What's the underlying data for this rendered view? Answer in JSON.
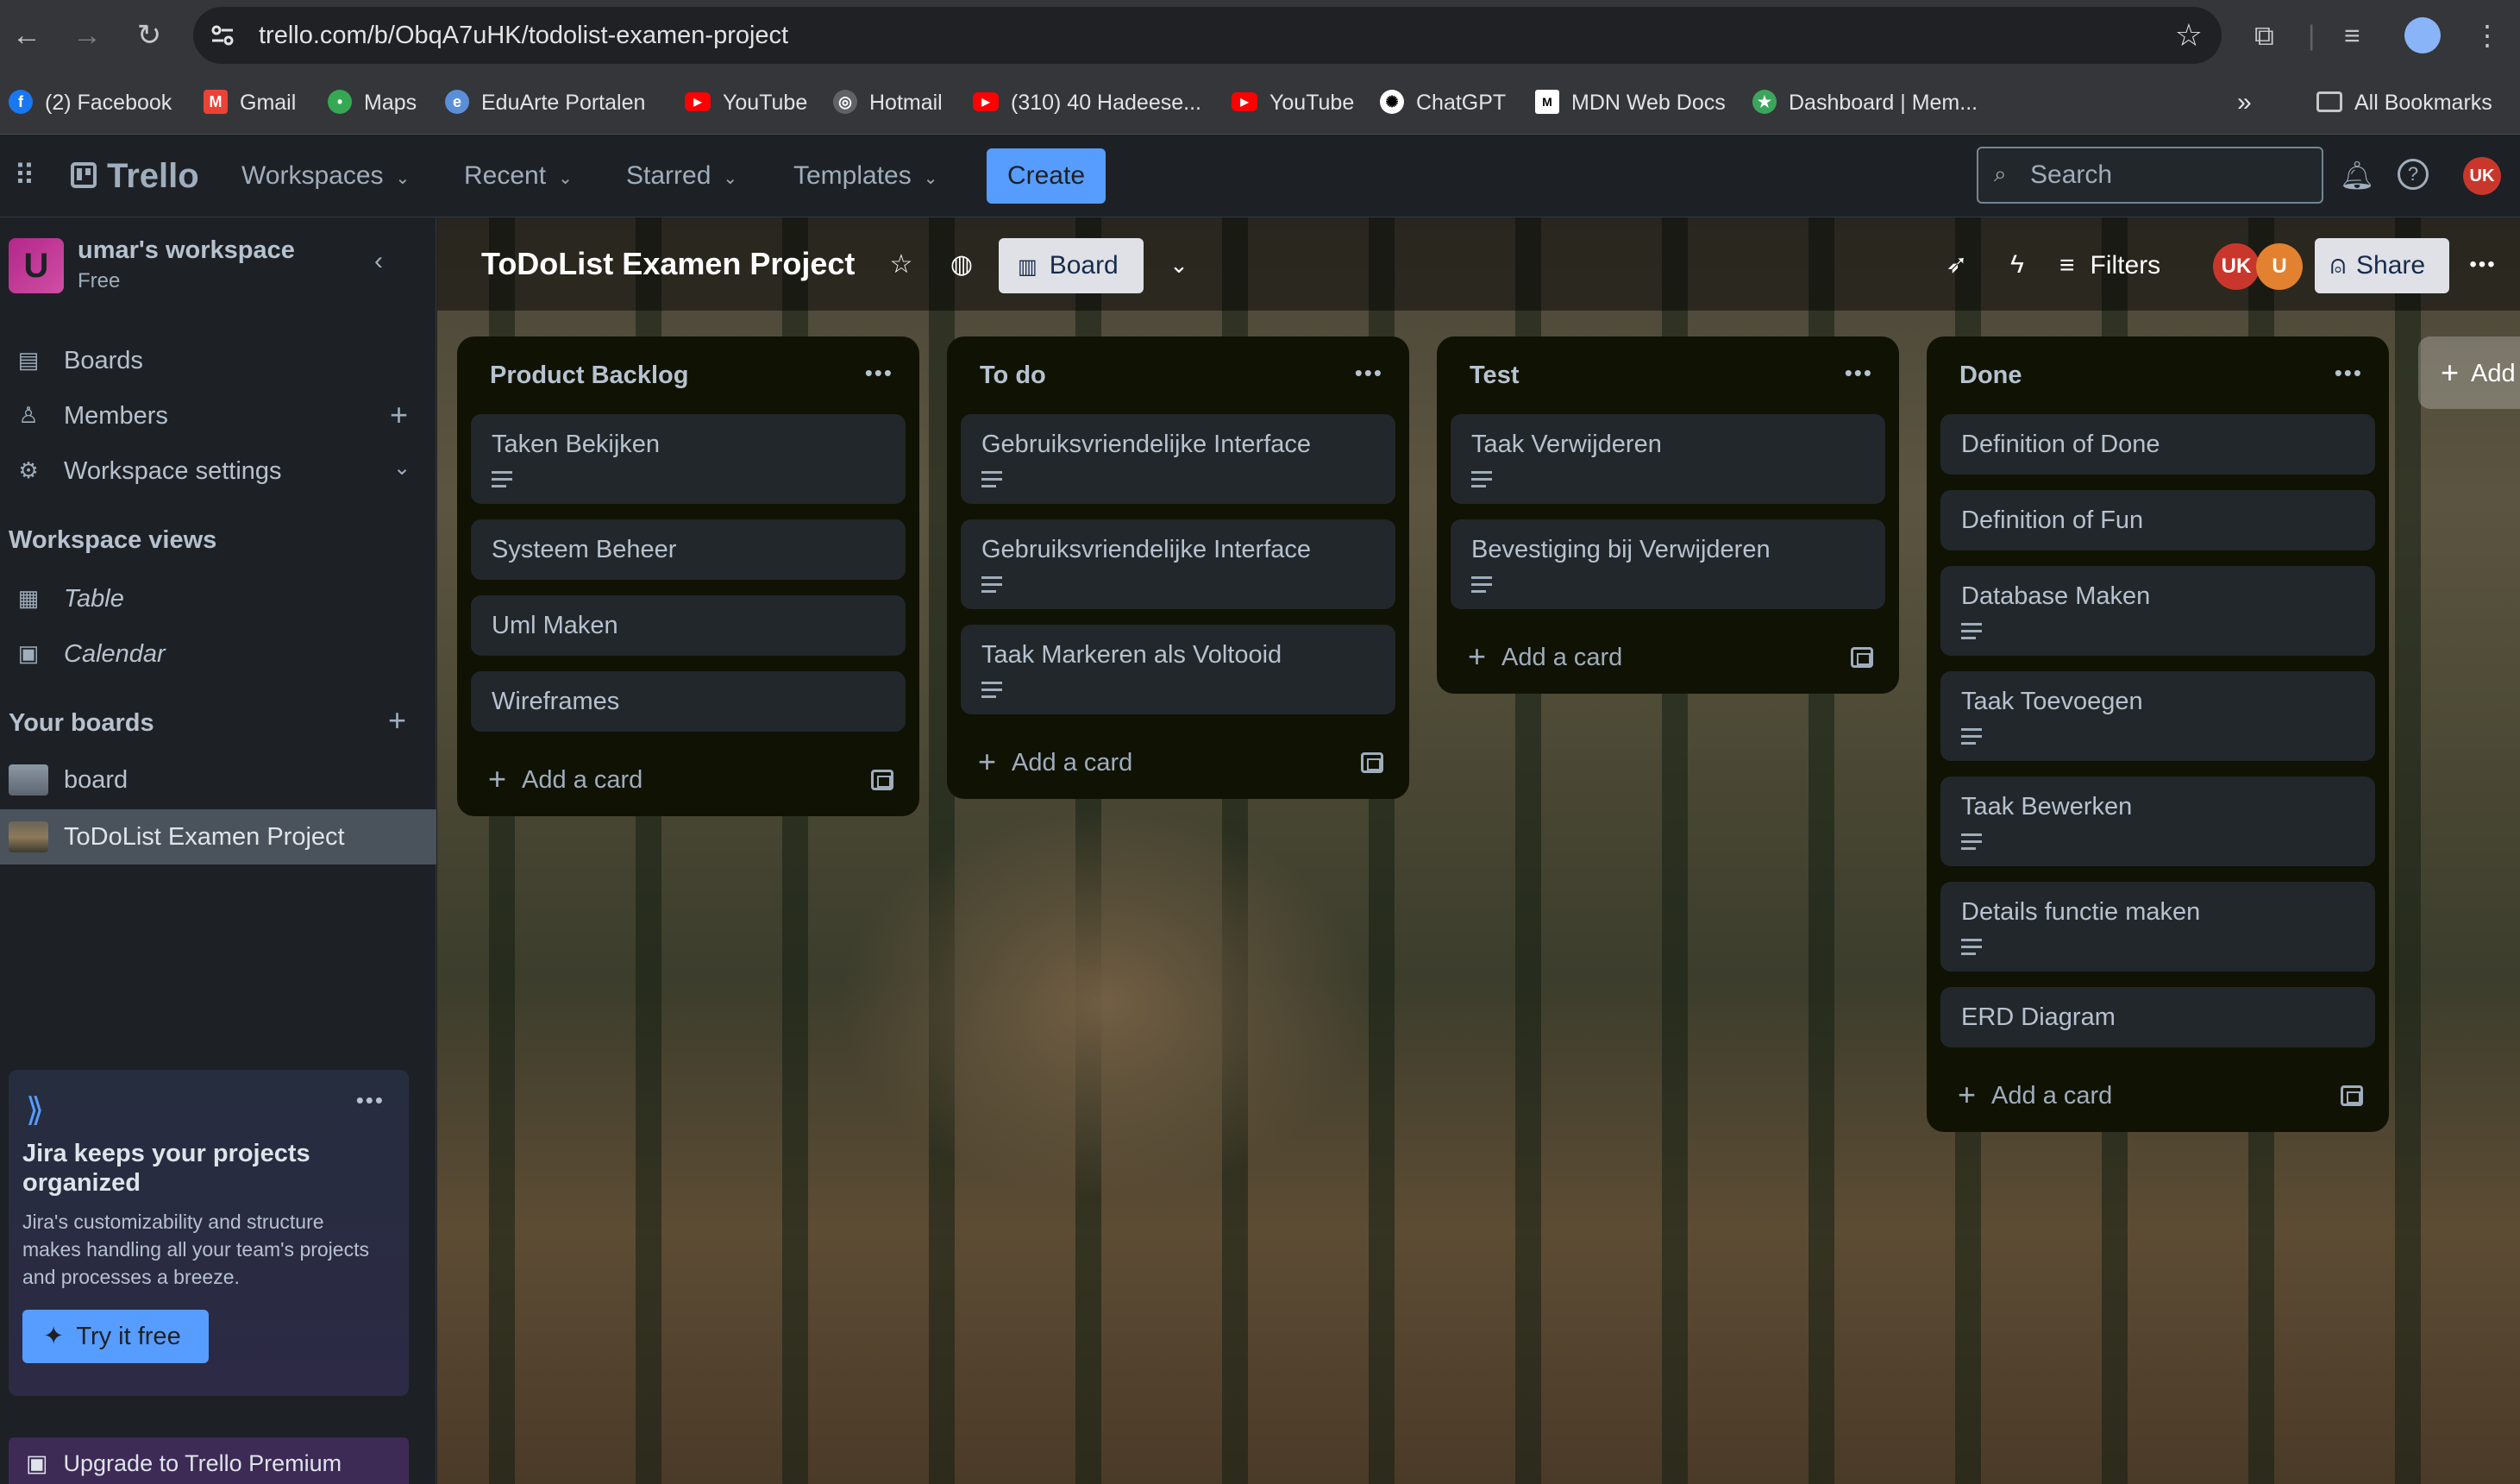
{
  "browser": {
    "url": "trello.com/b/ObqA7uHK/todolist-examen-project",
    "bookmarks": [
      {
        "label": "(2) Facebook",
        "icon": "facebook-icon"
      },
      {
        "label": "Gmail",
        "icon": "gmail-icon"
      },
      {
        "label": "Maps",
        "icon": "maps-icon"
      },
      {
        "label": "EduArte Portalen",
        "icon": "eduarte-icon"
      },
      {
        "label": "YouTube",
        "icon": "youtube-icon"
      },
      {
        "label": "Hotmail",
        "icon": "hotmail-icon"
      },
      {
        "label": "(310) 40 Hadeese...",
        "icon": "youtube-icon"
      },
      {
        "label": "YouTube",
        "icon": "youtube-icon"
      },
      {
        "label": "ChatGPT",
        "icon": "chatgpt-icon"
      },
      {
        "label": "MDN Web Docs",
        "icon": "mdn-icon"
      },
      {
        "label": "Dashboard | Mem...",
        "icon": "dashboard-icon"
      }
    ],
    "all_bookmarks": "All Bookmarks"
  },
  "header": {
    "logo": "Trello",
    "nav": [
      "Workspaces",
      "Recent",
      "Starred",
      "Templates"
    ],
    "create": "Create",
    "search_placeholder": "Search",
    "user_initials": "UK",
    "colors": {
      "accent": "#579dff",
      "avatar_red": "#c9372c",
      "avatar_orange": "#e2812f"
    }
  },
  "sidebar": {
    "workspace_initial": "U",
    "workspace_name": "umar's workspace",
    "workspace_plan": "Free",
    "items": [
      {
        "label": "Boards",
        "icon": "board-icon"
      },
      {
        "label": "Members",
        "icon": "person-icon"
      },
      {
        "label": "Workspace settings",
        "icon": "gear-icon"
      }
    ],
    "views_heading": "Workspace views",
    "views": [
      {
        "label": "Table",
        "icon": "table-icon"
      },
      {
        "label": "Calendar",
        "icon": "calendar-icon"
      }
    ],
    "your_boards_heading": "Your boards",
    "boards": [
      "board",
      "ToDoList Examen Project"
    ],
    "jira": {
      "title": "Jira keeps your projects organized",
      "body": "Jira's customizability and structure makes handling all your team's projects and processes a breeze.",
      "button": "Try it free"
    },
    "upgrade": "Upgrade to Trello Premium"
  },
  "board": {
    "title": "ToDoList Examen Project",
    "view": "Board",
    "filters": "Filters",
    "share": "Share",
    "members": [
      "UK",
      "U"
    ],
    "add_list": "Add another list",
    "add_list_visible": "Add"
  },
  "lists": [
    {
      "title": "Product Backlog",
      "cards": [
        {
          "title": "Taken Bekijken",
          "has_description": true
        },
        {
          "title": "Systeem Beheer",
          "has_description": false
        },
        {
          "title": "Uml Maken",
          "has_description": false
        },
        {
          "title": "Wireframes",
          "has_description": false
        }
      ],
      "add_card": "Add a card"
    },
    {
      "title": "To do",
      "cards": [
        {
          "title": "Gebruiksvriendelijke Interface",
          "has_description": true
        },
        {
          "title": "Gebruiksvriendelijke Interface",
          "has_description": true
        },
        {
          "title": "Taak Markeren als Voltooid",
          "has_description": true
        }
      ],
      "add_card": "Add a card"
    },
    {
      "title": "Test",
      "cards": [
        {
          "title": "Taak Verwijderen",
          "has_description": true
        },
        {
          "title": "Bevestiging bij Verwijderen",
          "has_description": true
        }
      ],
      "add_card": "Add a card"
    },
    {
      "title": "Done",
      "cards": [
        {
          "title": "Definition of Done",
          "has_description": false
        },
        {
          "title": "Definition of Fun",
          "has_description": false
        },
        {
          "title": "Database Maken",
          "has_description": true
        },
        {
          "title": "Taak Toevoegen",
          "has_description": true
        },
        {
          "title": "Taak Bewerken",
          "has_description": true
        },
        {
          "title": "Details functie maken",
          "has_description": true
        },
        {
          "title": "ERD Diagram",
          "has_description": false
        }
      ],
      "add_card": "Add a card"
    }
  ]
}
